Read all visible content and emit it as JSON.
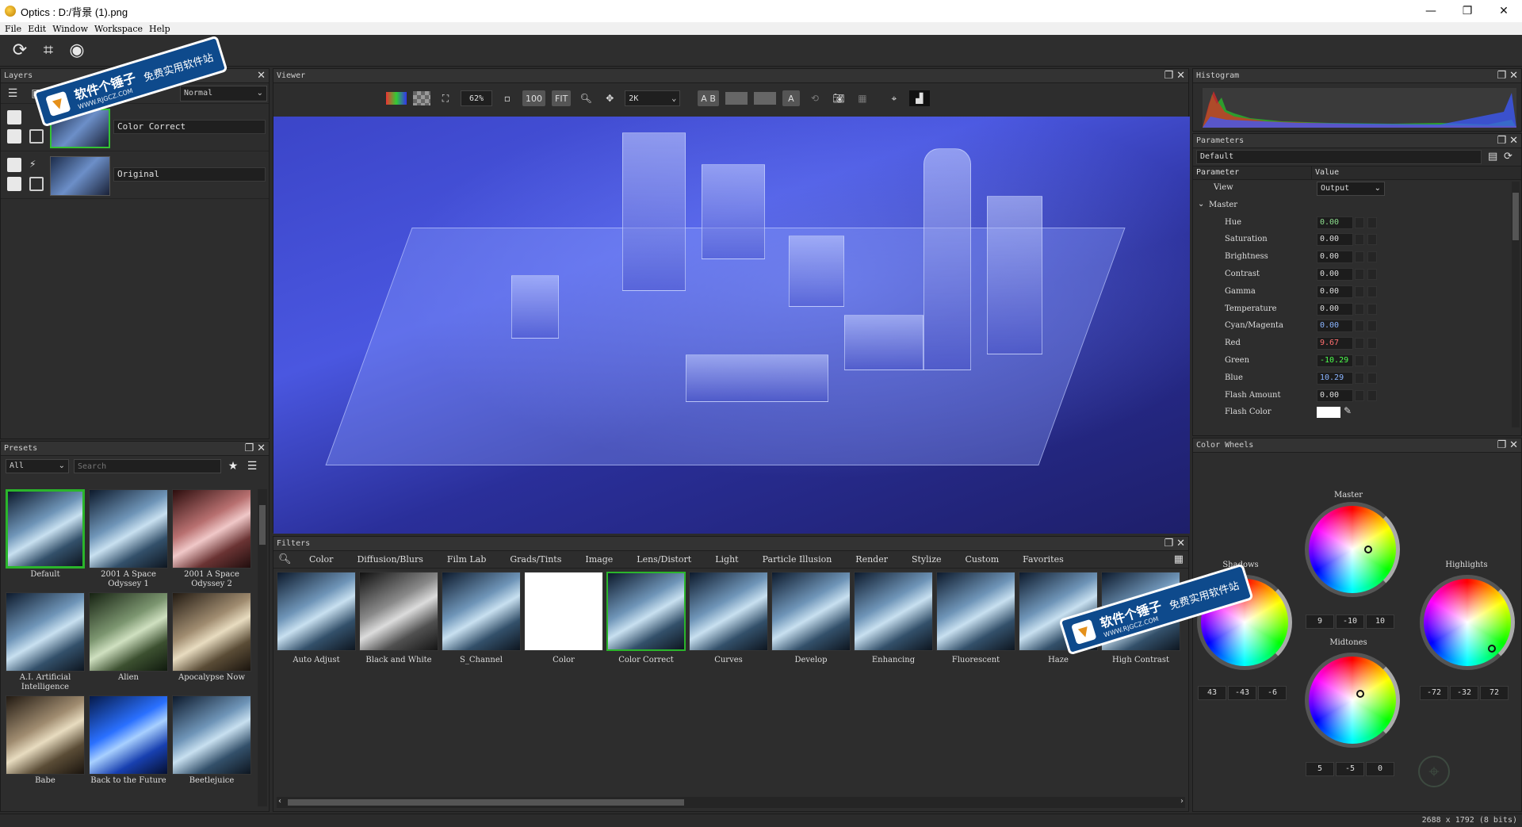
{
  "window": {
    "title": "Optics : D:/背景 (1).png",
    "controls": [
      "—",
      "❐",
      "✕"
    ]
  },
  "menu": [
    "File",
    "Edit",
    "Window",
    "Workspace",
    "Help"
  ],
  "main_toolbar": {
    "icons": [
      "refresh-icon",
      "crop-icon",
      "eye-target-icon"
    ]
  },
  "panels": {
    "layers": "Layers",
    "viewer": "Viewer",
    "histogram": "Histogram",
    "parameters": "Parameters",
    "presets": "Presets",
    "filters": "Filters",
    "color_wheels": "Color Wheels"
  },
  "layers": {
    "blend_mode": "Normal",
    "items": [
      {
        "name": "Color Correct",
        "selected": true
      },
      {
        "name": "Original",
        "selected": false
      }
    ]
  },
  "viewer_toolbar": {
    "zoom": "62%",
    "btn_100": "100",
    "btn_fit": "FIT",
    "resolution": "2K",
    "btn_ab": "A B",
    "btn_a": "A"
  },
  "presets": {
    "category": "All",
    "search_placeholder": "Search",
    "items": [
      {
        "label": "Default",
        "style": "thumb-city",
        "selected": true
      },
      {
        "label": "2001 A Space Odyssey 1",
        "style": "thumb-city",
        "selected": false
      },
      {
        "label": "2001 A Space Odyssey 2",
        "style": "thumb-red",
        "selected": false
      },
      {
        "label": "A.I. Artificial Intelligence",
        "style": "thumb-city",
        "selected": false
      },
      {
        "label": "Alien",
        "style": "thumb-green",
        "selected": false
      },
      {
        "label": "Apocalypse Now",
        "style": "thumb-sepia",
        "selected": false
      },
      {
        "label": "Babe",
        "style": "thumb-sepia",
        "selected": false
      },
      {
        "label": "Back to the Future",
        "style": "thumb-blue",
        "selected": false
      },
      {
        "label": "Beetlejuice",
        "style": "thumb-city",
        "selected": false
      }
    ]
  },
  "filters": {
    "tabs": [
      "Color",
      "Diffusion/Blurs",
      "Film Lab",
      "Grads/Tints",
      "Image",
      "Lens/Distort",
      "Light",
      "Particle Illusion",
      "Render",
      "Stylize",
      "Custom",
      "Favorites"
    ],
    "items": [
      {
        "label": "Auto Adjust",
        "style": "thumb-city",
        "selected": false
      },
      {
        "label": "Black and White",
        "style": "thumb-bw",
        "selected": false
      },
      {
        "label": "S_Channel",
        "style": "thumb-city",
        "selected": false
      },
      {
        "label": "Color",
        "style": "thumb-white",
        "selected": false
      },
      {
        "label": "Color Correct",
        "style": "thumb-city",
        "selected": true
      },
      {
        "label": "Curves",
        "style": "thumb-city",
        "selected": false
      },
      {
        "label": "Develop",
        "style": "thumb-city",
        "selected": false
      },
      {
        "label": "Enhancing",
        "style": "thumb-city",
        "selected": false
      },
      {
        "label": "Fluorescent",
        "style": "thumb-city",
        "selected": false
      },
      {
        "label": "Haze",
        "style": "thumb-city",
        "selected": false
      },
      {
        "label": "High Contrast",
        "style": "thumb-city",
        "selected": false
      }
    ]
  },
  "parameters": {
    "preset": "Default",
    "col_param": "Parameter",
    "col_value": "Value",
    "view_label": "View",
    "view_value": "Output",
    "group_label": "Master",
    "rows": [
      {
        "name": "Hue",
        "value": "0.00",
        "tone": "accent"
      },
      {
        "name": "Saturation",
        "value": "0.00",
        "tone": ""
      },
      {
        "name": "Brightness",
        "value": "0.00",
        "tone": ""
      },
      {
        "name": "Contrast",
        "value": "0.00",
        "tone": ""
      },
      {
        "name": "Gamma",
        "value": "0.00",
        "tone": ""
      },
      {
        "name": "Temperature",
        "value": "0.00",
        "tone": ""
      },
      {
        "name": "Cyan/Magenta",
        "value": "0.00",
        "tone": "blue"
      },
      {
        "name": "Red",
        "value": "9.67",
        "tone": "red"
      },
      {
        "name": "Green",
        "value": "-10.29",
        "tone": "green"
      },
      {
        "name": "Blue",
        "value": "10.29",
        "tone": "blue"
      },
      {
        "name": "Flash Amount",
        "value": "0.00",
        "tone": ""
      }
    ],
    "flash_color_label": "Flash Color"
  },
  "color_wheels": {
    "master": {
      "label": "Master",
      "values": [
        "9",
        "-10",
        "10"
      ]
    },
    "shadows": {
      "label": "Shadows",
      "values": [
        "43",
        "-43",
        "-6"
      ]
    },
    "midtones": {
      "label": "Midtones",
      "values": [
        "5",
        "-5",
        "0"
      ]
    },
    "highlights": {
      "label": "Highlights",
      "values": [
        "-72",
        "-32",
        "72"
      ]
    }
  },
  "status": {
    "info": "2688 x 1792 (8 bits)"
  },
  "watermark": {
    "name": "软件个锤子",
    "url": "WWW.RJGCZ.COM",
    "slogan": "免费实用软件站"
  }
}
